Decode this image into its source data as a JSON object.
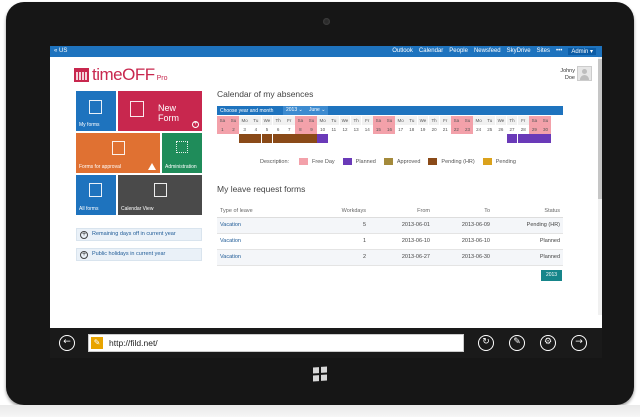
{
  "suitebar": {
    "brand": "« US",
    "links": [
      "Outlook",
      "Calendar",
      "People",
      "Newsfeed",
      "SkyDrive",
      "Sites",
      "•••"
    ],
    "admin": "Admin ▾"
  },
  "logo": {
    "time": "time",
    "off": "OFF",
    "pro": "Pro"
  },
  "user": {
    "first": "Johny",
    "last": "Doe"
  },
  "tiles": {
    "my_forms": "My forms",
    "new_form": "New Form",
    "forms_for_approval": "Forms for approval",
    "administration": "Administration",
    "all_forms": "All forms",
    "calendar_view": "Calendar View"
  },
  "side_links": {
    "remaining": "Remaining days off in current year",
    "holidays": "Public holidays in current year"
  },
  "calendar": {
    "title": "Calendar of my absences",
    "choose_label": "Choose year and month",
    "year": "2013 ⌄",
    "month": "June ⌄",
    "days": [
      {
        "d": "Sa",
        "n": "1",
        "c": "pink",
        "s": ""
      },
      {
        "d": "Su",
        "n": "2",
        "c": "pink",
        "s": ""
      },
      {
        "d": "Mo",
        "n": "3",
        "c": "",
        "s": "brown"
      },
      {
        "d": "Tu",
        "n": "4",
        "c": "",
        "s": "brown"
      },
      {
        "d": "We",
        "n": "5",
        "c": "",
        "s": "brown"
      },
      {
        "d": "Th",
        "n": "6",
        "c": "",
        "s": "brown"
      },
      {
        "d": "Fr",
        "n": "7",
        "c": "",
        "s": "brown"
      },
      {
        "d": "Sa",
        "n": "8",
        "c": "pink",
        "s": "brown"
      },
      {
        "d": "Su",
        "n": "9",
        "c": "pink",
        "s": "brown"
      },
      {
        "d": "Mo",
        "n": "10",
        "c": "",
        "s": "purple"
      },
      {
        "d": "Tu",
        "n": "11",
        "c": "",
        "s": ""
      },
      {
        "d": "We",
        "n": "12",
        "c": "",
        "s": ""
      },
      {
        "d": "Th",
        "n": "13",
        "c": "",
        "s": ""
      },
      {
        "d": "Fr",
        "n": "14",
        "c": "",
        "s": ""
      },
      {
        "d": "Sa",
        "n": "15",
        "c": "pink",
        "s": ""
      },
      {
        "d": "Su",
        "n": "16",
        "c": "pink",
        "s": ""
      },
      {
        "d": "Mo",
        "n": "17",
        "c": "",
        "s": ""
      },
      {
        "d": "Tu",
        "n": "18",
        "c": "",
        "s": ""
      },
      {
        "d": "We",
        "n": "19",
        "c": "",
        "s": ""
      },
      {
        "d": "Th",
        "n": "20",
        "c": "",
        "s": ""
      },
      {
        "d": "Fr",
        "n": "21",
        "c": "",
        "s": ""
      },
      {
        "d": "Sa",
        "n": "22",
        "c": "pink",
        "s": ""
      },
      {
        "d": "Su",
        "n": "23",
        "c": "pink",
        "s": ""
      },
      {
        "d": "Mo",
        "n": "24",
        "c": "",
        "s": ""
      },
      {
        "d": "Tu",
        "n": "25",
        "c": "",
        "s": ""
      },
      {
        "d": "We",
        "n": "26",
        "c": "",
        "s": ""
      },
      {
        "d": "Th",
        "n": "27",
        "c": "",
        "s": "purple"
      },
      {
        "d": "Fr",
        "n": "28",
        "c": "",
        "s": "purple"
      },
      {
        "d": "Sa",
        "n": "29",
        "c": "pink",
        "s": "purple"
      },
      {
        "d": "Su",
        "n": "30",
        "c": "pink",
        "s": "purple"
      }
    ],
    "legend_label": "Description:",
    "legend": [
      {
        "label": "Free Day",
        "color": "#f3a1aa"
      },
      {
        "label": "Planned",
        "color": "#6a3ab8"
      },
      {
        "label": "Approved",
        "color": "#a48a3b"
      },
      {
        "label": "Pending (HR)",
        "color": "#8a4a18"
      },
      {
        "label": "Pending",
        "color": "#dba21c"
      }
    ]
  },
  "forms": {
    "title": "My leave request forms",
    "headers": [
      "Type of leave",
      "Workdays",
      "From",
      "To",
      "Status"
    ],
    "rows": [
      [
        "Vacation",
        "5",
        "2013-06-01",
        "2013-06-09",
        "Pending (HR)"
      ],
      [
        "Vacation",
        "1",
        "2013-06-10",
        "2013-06-10",
        "Planned"
      ],
      [
        "Vacation",
        "2",
        "2013-06-27",
        "2013-06-30",
        "Planned"
      ]
    ],
    "year_button": "2013"
  },
  "browser": {
    "url": "http://fild.net/",
    "back_icon": "←",
    "refresh_icon": "↻",
    "pin_icon": "✎",
    "tools_icon": "⚙",
    "forward_icon": "→"
  },
  "colors": {
    "accent": "#1e73be",
    "brand": "#c8274e",
    "free_day": "#f3a1aa",
    "planned": "#6a3ab8",
    "pending_hr": "#8a4a18"
  }
}
